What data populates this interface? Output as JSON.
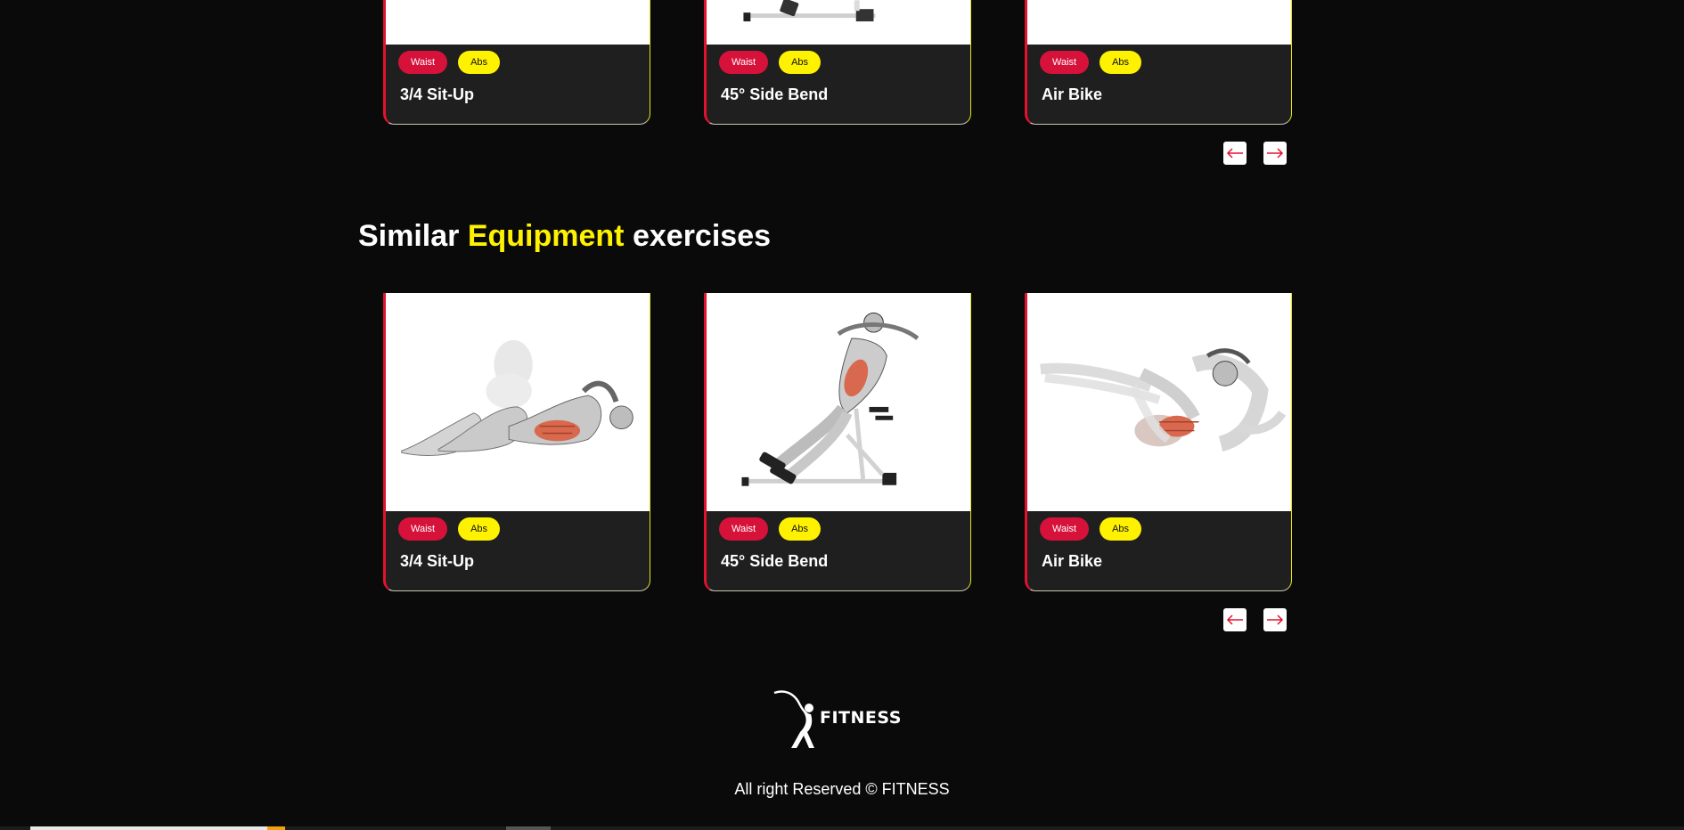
{
  "section_one": {
    "cards": [
      {
        "name": "3/4 Sit-Up",
        "body_part": "Waist",
        "target": "Abs"
      },
      {
        "name": "45° Side Bend",
        "body_part": "Waist",
        "target": "Abs"
      },
      {
        "name": "Air Bike",
        "body_part": "Waist",
        "target": "Abs"
      }
    ]
  },
  "section_two": {
    "title_prefix": "Similar",
    "title_highlight": "Equipment",
    "title_suffix": "exercises",
    "cards": [
      {
        "name": "3/4 Sit-Up",
        "body_part": "Waist",
        "target": "Abs"
      },
      {
        "name": "45° Side Bend",
        "body_part": "Waist",
        "target": "Abs"
      },
      {
        "name": "Air Bike",
        "body_part": "Waist",
        "target": "Abs"
      }
    ]
  },
  "pager": {
    "prev_icon": "arrow-left-icon",
    "next_icon": "arrow-right-icon"
  },
  "footer": {
    "brand": "FITNESS",
    "logo_icon": "stretching-figure-icon",
    "copyright": "All right Reserved © FITNESS"
  },
  "colors": {
    "background": "#0a0a0a",
    "card": "#1f1f1f",
    "accent_red": "#e3122f",
    "accent_yellow": "#fff200"
  }
}
